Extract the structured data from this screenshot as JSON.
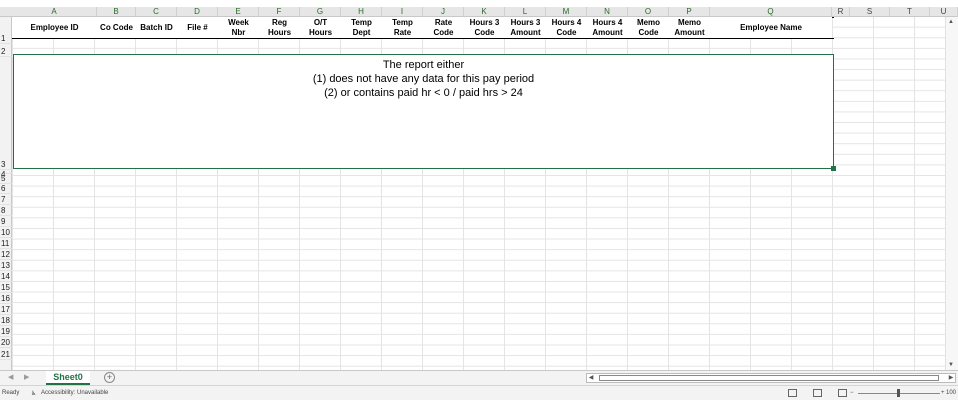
{
  "columns": [
    "A",
    "B",
    "C",
    "D",
    "E",
    "F",
    "G",
    "H",
    "I",
    "J",
    "K",
    "L",
    "M",
    "N",
    "O",
    "P",
    "Q",
    "R",
    "S",
    "T",
    "U"
  ],
  "rows": [
    "1",
    "2",
    "3",
    "4",
    "5",
    "6",
    "7",
    "8",
    "9",
    "10",
    "11",
    "12",
    "13",
    "14",
    "15",
    "16",
    "17",
    "18",
    "19",
    "20",
    "21"
  ],
  "header_cells": [
    {
      "line1": "Employee ID",
      "line2": ""
    },
    {
      "line1": "Co Code",
      "line2": ""
    },
    {
      "line1": "Batch ID",
      "line2": ""
    },
    {
      "line1": "File #",
      "line2": ""
    },
    {
      "line1": "Week",
      "line2": "Nbr"
    },
    {
      "line1": "Reg",
      "line2": "Hours"
    },
    {
      "line1": "O/T",
      "line2": "Hours"
    },
    {
      "line1": "Temp",
      "line2": "Dept"
    },
    {
      "line1": "Temp",
      "line2": "Rate"
    },
    {
      "line1": "Rate",
      "line2": "Code"
    },
    {
      "line1": "Hours 3",
      "line2": "Code"
    },
    {
      "line1": "Hours 3",
      "line2": "Amount"
    },
    {
      "line1": "Hours 4",
      "line2": "Code"
    },
    {
      "line1": "Hours 4",
      "line2": "Amount"
    },
    {
      "line1": "Memo",
      "line2": "Code"
    },
    {
      "line1": "Memo",
      "line2": "Amount"
    },
    {
      "line1": "Employee Name",
      "line2": ""
    }
  ],
  "message": {
    "line1": "The report either",
    "line2": "(1) does not have any data for this pay period",
    "line3": "(2) or contains paid hr < 0 / paid hrs > 24"
  },
  "sheet_tab": "Sheet0",
  "add_sheet": "+",
  "status": {
    "ready": "Ready",
    "accessibility": "Accessibility: Unavailable",
    "zoom": "100"
  },
  "colors": {
    "accent": "#217346"
  }
}
